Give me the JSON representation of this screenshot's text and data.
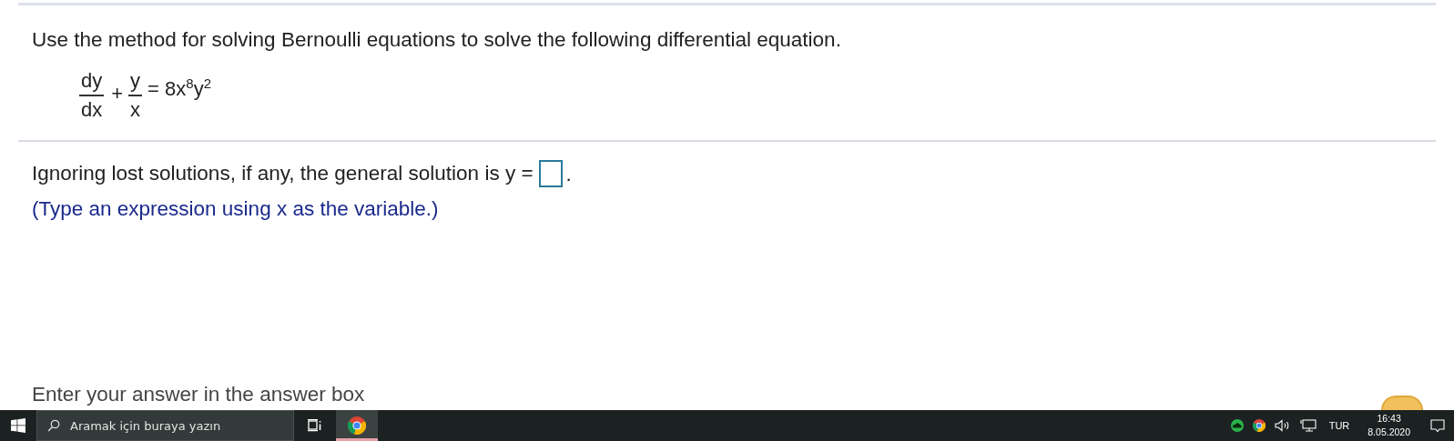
{
  "question": {
    "prompt": "Use the method for solving Bernoulli equations to solve the following differential equation.",
    "equation": [
      {
        "kind": "fraction",
        "numerator": "dy",
        "denominator": "dx"
      },
      {
        "kind": "operator",
        "text": "+"
      },
      {
        "kind": "fraction",
        "numerator": "y",
        "denominator": "x"
      },
      {
        "kind": "text",
        "text": "= 8x$^{8}$y$^{2}$"
      }
    ]
  },
  "answer": {
    "lead": "Ignoring lost solutions, if any, the general solution is y =",
    "trail": ".",
    "hint": "(Type an expression using x as the variable.)"
  },
  "footer_hint": "Enter your answer in the answer box",
  "taskbar": {
    "search_placeholder": "Aramak için buraya yazın",
    "apps": [
      {
        "kind": "task-view",
        "running": false
      },
      {
        "kind": "chrome",
        "running": true
      }
    ],
    "tray": {
      "language": "TUR",
      "time": "16:43",
      "date": "8.05.2020"
    }
  }
}
